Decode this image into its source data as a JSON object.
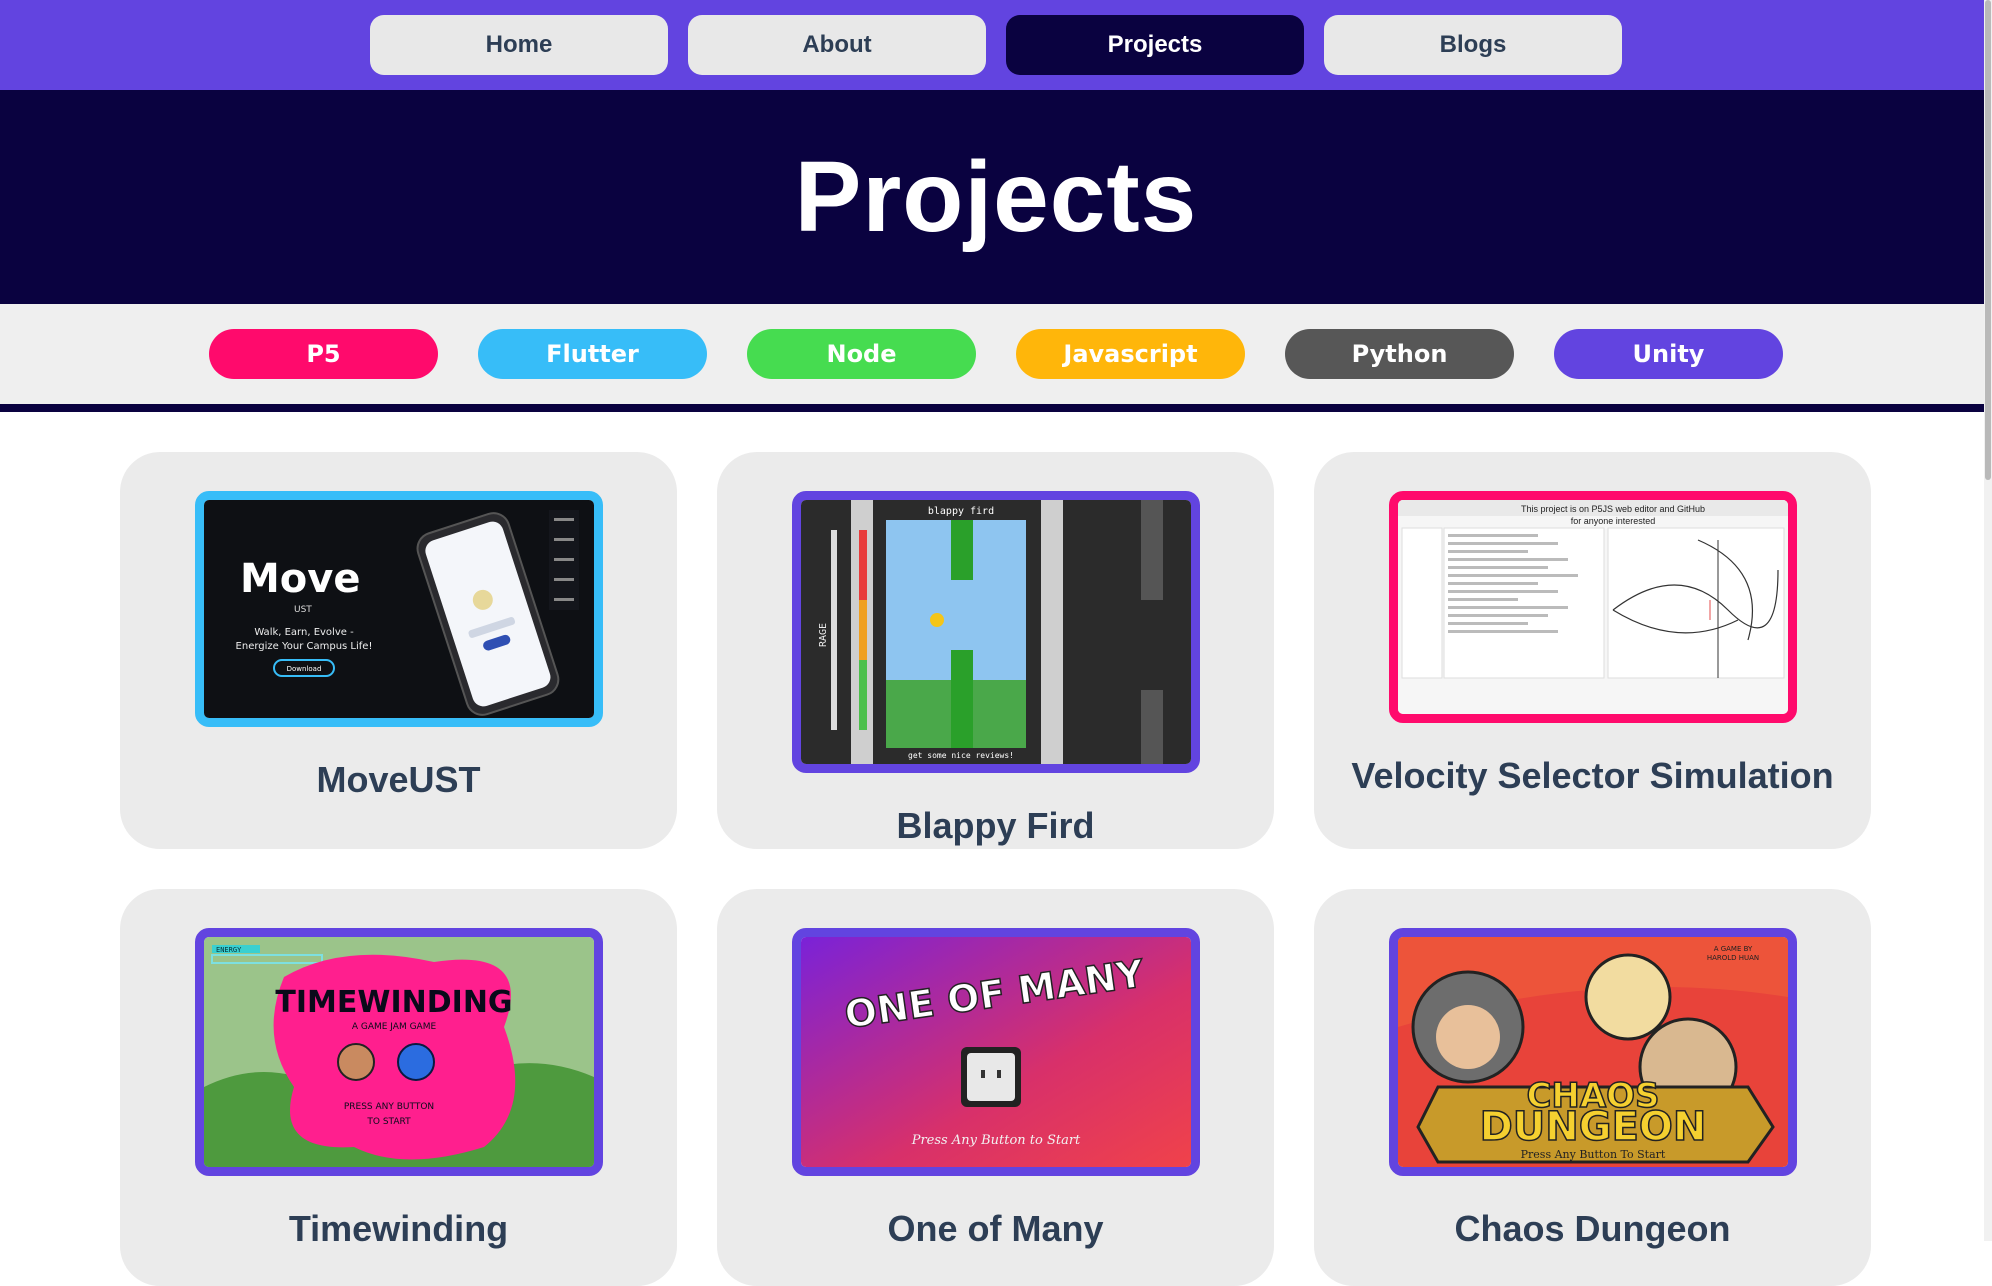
{
  "nav": {
    "items": [
      {
        "label": "Home",
        "active": false
      },
      {
        "label": "About",
        "active": false
      },
      {
        "label": "Projects",
        "active": true
      },
      {
        "label": "Blogs",
        "active": false
      }
    ]
  },
  "hero": {
    "title": "Projects"
  },
  "filters": [
    {
      "label": "P5",
      "color": "#ff0a6c"
    },
    {
      "label": "Flutter",
      "color": "#37bdf8"
    },
    {
      "label": "Node",
      "color": "#46dc50"
    },
    {
      "label": "Javascript",
      "color": "#ffb60a"
    },
    {
      "label": "Python",
      "color": "#575757"
    },
    {
      "label": "Unity",
      "color": "#6244e0"
    }
  ],
  "projects": [
    {
      "title": "MoveUST",
      "border": "#37bdf8",
      "thumb": {
        "logo": "Move",
        "sub": "UST",
        "tagline1": "Walk, Earn, Evolve -",
        "tagline2": "Energize Your Campus Life!",
        "button": "Download"
      }
    },
    {
      "title": "Blappy Fird",
      "border": "#6244e0",
      "thumb": {
        "header": "blappy fird",
        "meter": "RAGE",
        "footer": "get some nice reviews!"
      }
    },
    {
      "title": "Velocity Selector Simulation",
      "border": "#ff0a6c",
      "thumb": {
        "caption1": "This project is on P5JS web editor and GitHub",
        "caption2": "for anyone interested"
      }
    },
    {
      "title": "Timewinding",
      "border": "#6244e0",
      "thumb": {
        "energy": "ENERGY",
        "logo": "TIMEWINDING",
        "sub": "A GAME JAM GAME",
        "press1": "PRESS ANY BUTTON",
        "press2": "TO START"
      }
    },
    {
      "title": "One of Many",
      "border": "#6244e0",
      "thumb": {
        "logo": "ONE OF MANY",
        "press": "Press Any Button to Start"
      }
    },
    {
      "title": "Chaos Dungeon",
      "border": "#6244e0",
      "thumb": {
        "credit1": "A GAME BY",
        "credit2": "HAROLD HUAN",
        "logo1": "CHAOS",
        "logo2": "DUNGEON",
        "press": "Press Any Button To Start"
      }
    }
  ]
}
